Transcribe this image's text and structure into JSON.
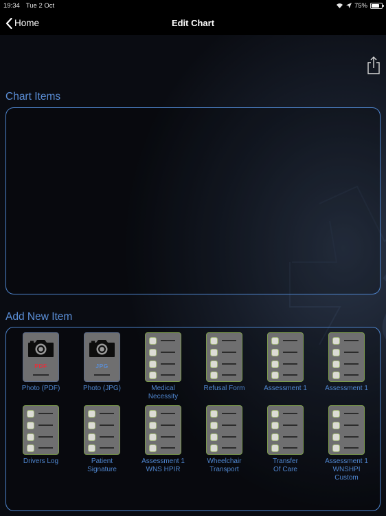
{
  "status_bar": {
    "time": "19:34",
    "date": "Tue 2 Oct",
    "wifi_icon": "wifi-icon",
    "location_icon": "location-arrow-icon",
    "battery_percent": "75%",
    "battery_level": 0.75
  },
  "nav": {
    "back_label": "Home",
    "title": "Edit Chart"
  },
  "share_icon": "share-icon",
  "chart_items": {
    "title": "Chart Items",
    "items": []
  },
  "add_new_item": {
    "title": "Add New Item",
    "items": [
      {
        "label": "Photo (PDF)",
        "icon": "camera-icon",
        "format": "PDF",
        "format_color": "#e0323c"
      },
      {
        "label": "Photo (JPG)",
        "icon": "camera-icon",
        "format": "JPG",
        "format_color": "#5b8fd8"
      },
      {
        "label": "Medical\nNecessity",
        "icon": "checklist-icon"
      },
      {
        "label": "Refusal Form",
        "icon": "checklist-icon"
      },
      {
        "label": "Assessment 1",
        "icon": "checklist-icon"
      },
      {
        "label": "Assessment 1",
        "icon": "checklist-icon"
      },
      {
        "label": "Drivers Log",
        "icon": "checklist-icon"
      },
      {
        "label": "Patient\nSignature",
        "icon": "checklist-icon"
      },
      {
        "label": "Assessment 1\nWNS HPIR",
        "icon": "checklist-icon"
      },
      {
        "label": "Wheelchair\nTransport",
        "icon": "checklist-icon"
      },
      {
        "label": "Transfer\nOf Care",
        "icon": "checklist-icon"
      },
      {
        "label": "Assessment 1\nWNSHPI\nCustom",
        "icon": "checklist-icon"
      }
    ]
  }
}
